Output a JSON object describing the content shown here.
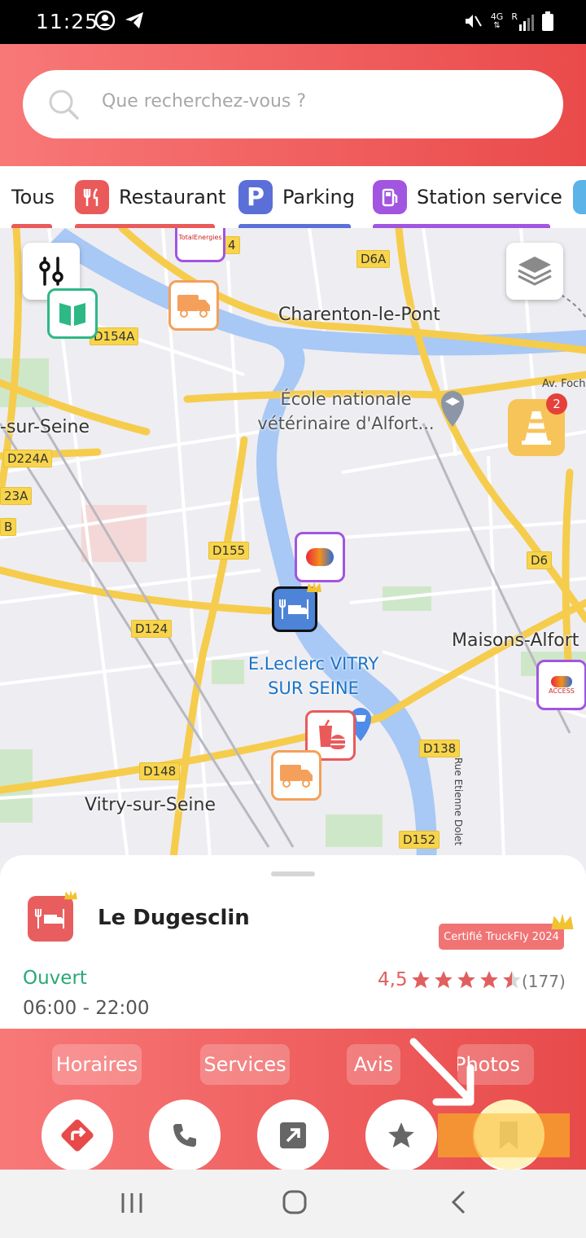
{
  "status_bar": {
    "time": "11:25",
    "left_icons": [
      "account-icon",
      "telegram-icon"
    ],
    "right_icons": [
      "mute-icon",
      "network-4g-icon",
      "signal-icon",
      "battery-icon"
    ],
    "network": "4G",
    "roaming": "R"
  },
  "search": {
    "placeholder": "Que recherchez-vous ?"
  },
  "categories": [
    {
      "label": "Tous",
      "color": "#ea5a5a"
    },
    {
      "label": "Restaurant",
      "color": "#ea5a5a",
      "icon": "fork-knife-icon"
    },
    {
      "label": "Parking",
      "color": "#5b6fd8",
      "icon": "parking-icon"
    },
    {
      "label": "Station service",
      "color": "#a155e0",
      "icon": "fuel-pump-icon"
    }
  ],
  "map": {
    "roads": [
      "D6A",
      "D154A",
      "D224A",
      "23A",
      "B",
      "D155",
      "D124",
      "D6",
      "D138",
      "D148",
      "D152",
      "4"
    ],
    "places": [
      "Charenton-le-Pont",
      "-sur-Seine",
      "Maisons-Alfort",
      "Vitry-sur-Seine"
    ],
    "poi_ecole_line1": "École nationale",
    "poi_ecole_line2": "vétérinaire d'Alfort...",
    "poi_leclerc_line1": "E.Leclerc VITRY",
    "poi_leclerc_line2": "SUR SEINE",
    "street_small": "Av. Foch",
    "street_rue": "Rue Etienne Dolet",
    "alert_count": "2",
    "pin_totalenergies_text": "TotalEnergies",
    "pin_access_text": "ACCESS"
  },
  "place": {
    "name": "Le Dugesclin",
    "certification": "Certifié TruckFly 2024",
    "status": "Ouvert",
    "hours": "06:00 - 22:00",
    "rating": "4,5",
    "rating_value": 4.5,
    "review_count": "(177)"
  },
  "tabs": [
    {
      "label": "Horaires"
    },
    {
      "label": "Services"
    },
    {
      "label": "Avis"
    },
    {
      "label": "Photos"
    }
  ],
  "actions": [
    "directions-icon",
    "phone-icon",
    "share-icon",
    "star-icon",
    "bookmark-icon"
  ],
  "colors": {
    "accent": "#ea5a5a",
    "open": "#2aa876",
    "rating": "#e06060",
    "restaurant": "#ea5a5a",
    "parking": "#5b6fd8",
    "fuel": "#a155e0"
  }
}
